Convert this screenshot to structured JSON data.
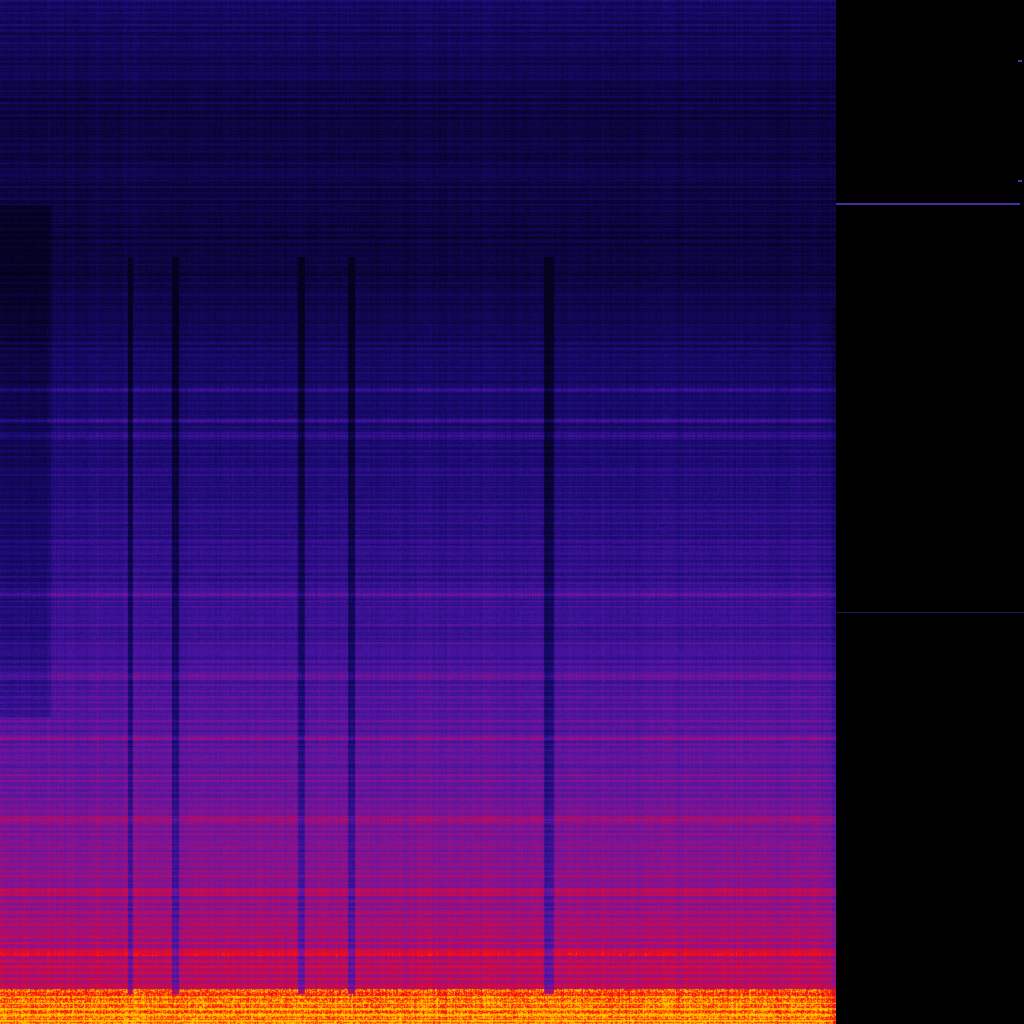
{
  "image": {
    "kind": "spectrogram",
    "colormap": "blue-purple-red-yellow",
    "colors": {
      "background": "#000000",
      "low": "#0a0440",
      "mid": "#6a1aa8",
      "high": "#ff1000",
      "peak": "#ffc000",
      "marker": "#4a2aa8"
    },
    "dark_time_segments": [
      {
        "start": 0.152,
        "end": 0.158
      },
      {
        "start": 0.205,
        "end": 0.214
      },
      {
        "start": 0.356,
        "end": 0.364
      },
      {
        "start": 0.416,
        "end": 0.424
      },
      {
        "start": 0.65,
        "end": 0.662
      }
    ],
    "harmonic_band_levels": [
      0.38,
      0.41,
      0.425,
      0.58,
      0.66,
      0.72,
      0.8,
      0.87,
      0.93
    ]
  }
}
